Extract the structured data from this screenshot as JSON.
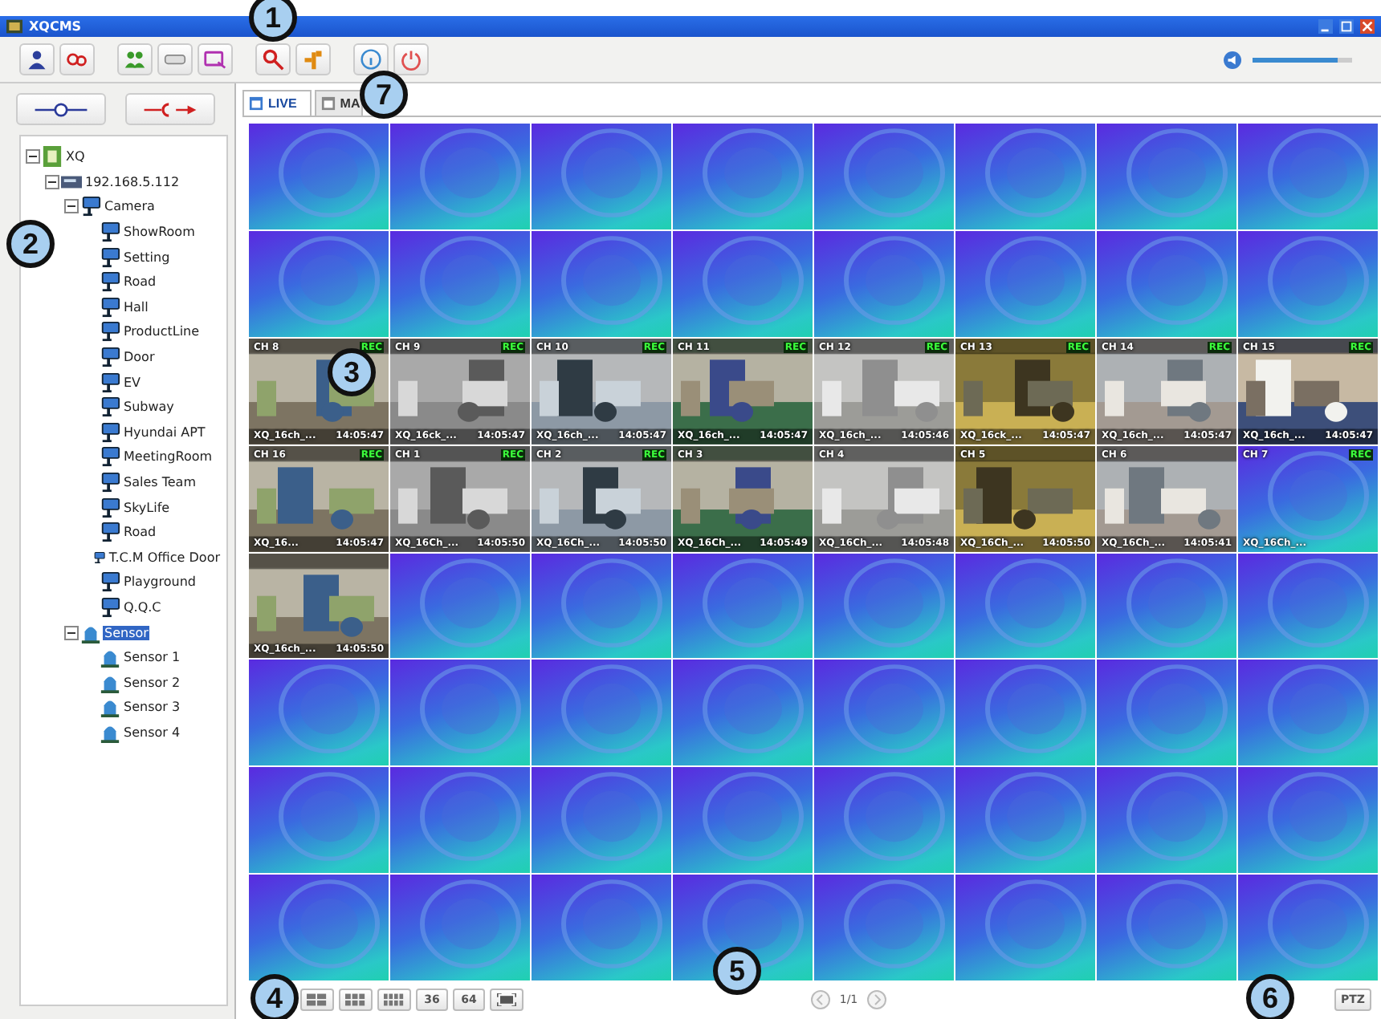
{
  "window": {
    "title": "XQCMS"
  },
  "toolbar": [
    {
      "kind": "user"
    },
    {
      "kind": "link"
    },
    {
      "kind": "sep"
    },
    {
      "kind": "group"
    },
    {
      "kind": "bar"
    },
    {
      "kind": "screen"
    },
    {
      "kind": "sep"
    },
    {
      "kind": "search"
    },
    {
      "kind": "tool"
    },
    {
      "kind": "sep"
    },
    {
      "kind": "info"
    },
    {
      "kind": "power"
    }
  ],
  "volume": {
    "level": 0.85
  },
  "connect_buttons": [
    {
      "kind": "connect"
    },
    {
      "kind": "disconnect"
    }
  ],
  "tree": [
    {
      "label": "XQ",
      "kind": "site",
      "expanded": true,
      "selected": false,
      "children": [
        {
          "label": "192.168.5.112",
          "kind": "server",
          "expanded": true,
          "selected": false,
          "children": [
            {
              "label": "Camera",
              "kind": "group",
              "expanded": true,
              "selected": false,
              "children": [
                {
                  "label": "ShowRoom",
                  "kind": "camera",
                  "selected": false
                },
                {
                  "label": "Setting",
                  "kind": "camera",
                  "selected": false
                },
                {
                  "label": "Road",
                  "kind": "camera",
                  "selected": false
                },
                {
                  "label": "Hall",
                  "kind": "camera",
                  "selected": false
                },
                {
                  "label": "ProductLine",
                  "kind": "camera",
                  "selected": false
                },
                {
                  "label": "Door",
                  "kind": "camera",
                  "selected": false
                },
                {
                  "label": "EV",
                  "kind": "camera",
                  "selected": false
                },
                {
                  "label": "Subway",
                  "kind": "camera",
                  "selected": false
                },
                {
                  "label": "Hyundai APT",
                  "kind": "camera",
                  "selected": false
                },
                {
                  "label": "MeetingRoom",
                  "kind": "camera",
                  "selected": false
                },
                {
                  "label": "Sales Team",
                  "kind": "camera",
                  "selected": false
                },
                {
                  "label": "SkyLife",
                  "kind": "camera",
                  "selected": false
                },
                {
                  "label": "Road",
                  "kind": "camera",
                  "selected": false
                },
                {
                  "label": "T.C.M Office Door",
                  "kind": "camera",
                  "selected": false
                },
                {
                  "label": "Playground",
                  "kind": "camera",
                  "selected": false
                },
                {
                  "label": "Q.Q.C",
                  "kind": "camera",
                  "selected": false
                }
              ]
            },
            {
              "label": "Sensor",
              "kind": "sensors",
              "expanded": true,
              "selected": true,
              "children": [
                {
                  "label": "Sensor 1",
                  "kind": "sensor",
                  "selected": false
                },
                {
                  "label": "Sensor 2",
                  "kind": "sensor",
                  "selected": false
                },
                {
                  "label": "Sensor 3",
                  "kind": "sensor",
                  "selected": false
                },
                {
                  "label": "Sensor 4",
                  "kind": "sensor",
                  "selected": false
                }
              ]
            }
          ]
        }
      ]
    }
  ],
  "tabs": [
    {
      "label": "LIVE",
      "selected": true
    },
    {
      "label": "MA",
      "selected": false
    }
  ],
  "tiles": [
    {
      "kind": "idle"
    },
    {
      "kind": "idle"
    },
    {
      "kind": "idle"
    },
    {
      "kind": "idle"
    },
    {
      "kind": "idle"
    },
    {
      "kind": "idle"
    },
    {
      "kind": "idle"
    },
    {
      "kind": "idle"
    },
    {
      "kind": "idle"
    },
    {
      "kind": "idle"
    },
    {
      "kind": "idle"
    },
    {
      "kind": "idle"
    },
    {
      "kind": "idle"
    },
    {
      "kind": "idle"
    },
    {
      "kind": "idle"
    },
    {
      "kind": "idle"
    },
    {
      "kind": "video",
      "ch": "CH 8",
      "badge": "REC",
      "source": "XQ_16ch_...",
      "time": "14:05:47"
    },
    {
      "kind": "video",
      "ch": "CH 9",
      "badge": "REC",
      "source": "XQ_16ck_...",
      "time": "14:05:47"
    },
    {
      "kind": "video",
      "ch": "CH 10",
      "badge": "REC",
      "source": "XQ_16ch_...",
      "time": "14:05:47"
    },
    {
      "kind": "video",
      "ch": "CH 11",
      "badge": "REC",
      "source": "XQ_16ch_...",
      "time": "14:05:47"
    },
    {
      "kind": "video",
      "ch": "CH 12",
      "badge": "REC",
      "source": "XQ_16ch_...",
      "time": "14:05:46"
    },
    {
      "kind": "video",
      "ch": "CH 13",
      "badge": "REC",
      "source": "XQ_16ck_...",
      "time": "14:05:47"
    },
    {
      "kind": "video",
      "ch": "CH 14",
      "badge": "REC",
      "source": "XQ_16ch_...",
      "time": "14:05:47"
    },
    {
      "kind": "video",
      "ch": "CH 15",
      "badge": "REC",
      "source": "XQ_16ch_...",
      "time": "14:05:47"
    },
    {
      "kind": "video",
      "ch": "CH 16",
      "badge": "REC",
      "source": "XQ_16...",
      "time": "14:05:47"
    },
    {
      "kind": "video",
      "ch": "CH 1",
      "badge": "REC",
      "source": "XQ_16Ch_...",
      "time": "14:05:50"
    },
    {
      "kind": "video",
      "ch": "CH 2",
      "badge": "REC",
      "source": "XQ_16Ch_...",
      "time": "14:05:50"
    },
    {
      "kind": "video",
      "ch": "CH 3",
      "source": "XQ_16Ch_...",
      "time": "14:05:49"
    },
    {
      "kind": "video",
      "ch": "CH 4",
      "source": "XQ_16Ch_...",
      "time": "14:05:48"
    },
    {
      "kind": "video",
      "ch": "CH 5",
      "source": "XQ_16Ch_...",
      "time": "14:05:50"
    },
    {
      "kind": "video",
      "ch": "CH 6",
      "source": "XQ_16Ch_...",
      "time": "14:05:41"
    },
    {
      "kind": "idle",
      "ch": "CH 7",
      "badge": "REC",
      "source": "XQ_16Ch_..."
    },
    {
      "kind": "video",
      "source": "XQ_16ch_...",
      "time": "14:05:50"
    },
    {
      "kind": "idle"
    },
    {
      "kind": "idle"
    },
    {
      "kind": "idle"
    },
    {
      "kind": "idle"
    },
    {
      "kind": "idle"
    },
    {
      "kind": "idle"
    },
    {
      "kind": "idle"
    },
    {
      "kind": "idle"
    },
    {
      "kind": "idle"
    },
    {
      "kind": "idle"
    },
    {
      "kind": "idle"
    },
    {
      "kind": "idle"
    },
    {
      "kind": "idle"
    },
    {
      "kind": "idle"
    },
    {
      "kind": "idle"
    },
    {
      "kind": "idle"
    },
    {
      "kind": "idle"
    },
    {
      "kind": "idle"
    },
    {
      "kind": "idle"
    },
    {
      "kind": "idle"
    },
    {
      "kind": "idle"
    },
    {
      "kind": "idle"
    },
    {
      "kind": "idle"
    },
    {
      "kind": "idle"
    },
    {
      "kind": "idle"
    },
    {
      "kind": "idle"
    },
    {
      "kind": "idle"
    },
    {
      "kind": "idle"
    },
    {
      "kind": "idle"
    },
    {
      "kind": "idle"
    },
    {
      "kind": "idle"
    }
  ],
  "layout_buttons": [
    {
      "kind": "grid"
    },
    {
      "kind": "grid"
    },
    {
      "kind": "grid"
    },
    {
      "kind": "text",
      "label": "36"
    },
    {
      "kind": "text",
      "label": "64"
    },
    {
      "kind": "fullscreen"
    }
  ],
  "pager": {
    "page": "1/1"
  },
  "ptz_button": {
    "label": "PTZ"
  },
  "callouts": [
    {
      "label": "1"
    },
    {
      "label": "2"
    },
    {
      "label": "3"
    },
    {
      "label": "4"
    },
    {
      "label": "5"
    },
    {
      "label": "6"
    },
    {
      "label": "7"
    }
  ]
}
